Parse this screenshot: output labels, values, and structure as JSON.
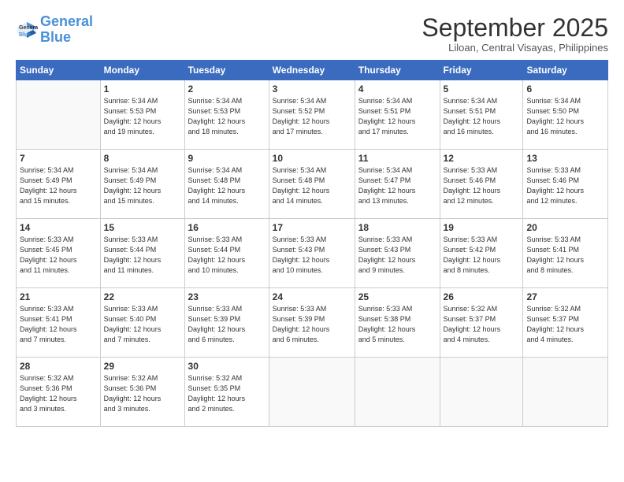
{
  "header": {
    "logo_general": "General",
    "logo_blue": "Blue",
    "month_title": "September 2025",
    "subtitle": "Liloan, Central Visayas, Philippines"
  },
  "weekdays": [
    "Sunday",
    "Monday",
    "Tuesday",
    "Wednesday",
    "Thursday",
    "Friday",
    "Saturday"
  ],
  "weeks": [
    [
      {
        "day": "",
        "info": ""
      },
      {
        "day": "1",
        "info": "Sunrise: 5:34 AM\nSunset: 5:53 PM\nDaylight: 12 hours\nand 19 minutes."
      },
      {
        "day": "2",
        "info": "Sunrise: 5:34 AM\nSunset: 5:53 PM\nDaylight: 12 hours\nand 18 minutes."
      },
      {
        "day": "3",
        "info": "Sunrise: 5:34 AM\nSunset: 5:52 PM\nDaylight: 12 hours\nand 17 minutes."
      },
      {
        "day": "4",
        "info": "Sunrise: 5:34 AM\nSunset: 5:51 PM\nDaylight: 12 hours\nand 17 minutes."
      },
      {
        "day": "5",
        "info": "Sunrise: 5:34 AM\nSunset: 5:51 PM\nDaylight: 12 hours\nand 16 minutes."
      },
      {
        "day": "6",
        "info": "Sunrise: 5:34 AM\nSunset: 5:50 PM\nDaylight: 12 hours\nand 16 minutes."
      }
    ],
    [
      {
        "day": "7",
        "info": "Sunrise: 5:34 AM\nSunset: 5:49 PM\nDaylight: 12 hours\nand 15 minutes."
      },
      {
        "day": "8",
        "info": "Sunrise: 5:34 AM\nSunset: 5:49 PM\nDaylight: 12 hours\nand 15 minutes."
      },
      {
        "day": "9",
        "info": "Sunrise: 5:34 AM\nSunset: 5:48 PM\nDaylight: 12 hours\nand 14 minutes."
      },
      {
        "day": "10",
        "info": "Sunrise: 5:34 AM\nSunset: 5:48 PM\nDaylight: 12 hours\nand 14 minutes."
      },
      {
        "day": "11",
        "info": "Sunrise: 5:34 AM\nSunset: 5:47 PM\nDaylight: 12 hours\nand 13 minutes."
      },
      {
        "day": "12",
        "info": "Sunrise: 5:33 AM\nSunset: 5:46 PM\nDaylight: 12 hours\nand 12 minutes."
      },
      {
        "day": "13",
        "info": "Sunrise: 5:33 AM\nSunset: 5:46 PM\nDaylight: 12 hours\nand 12 minutes."
      }
    ],
    [
      {
        "day": "14",
        "info": "Sunrise: 5:33 AM\nSunset: 5:45 PM\nDaylight: 12 hours\nand 11 minutes."
      },
      {
        "day": "15",
        "info": "Sunrise: 5:33 AM\nSunset: 5:44 PM\nDaylight: 12 hours\nand 11 minutes."
      },
      {
        "day": "16",
        "info": "Sunrise: 5:33 AM\nSunset: 5:44 PM\nDaylight: 12 hours\nand 10 minutes."
      },
      {
        "day": "17",
        "info": "Sunrise: 5:33 AM\nSunset: 5:43 PM\nDaylight: 12 hours\nand 10 minutes."
      },
      {
        "day": "18",
        "info": "Sunrise: 5:33 AM\nSunset: 5:43 PM\nDaylight: 12 hours\nand 9 minutes."
      },
      {
        "day": "19",
        "info": "Sunrise: 5:33 AM\nSunset: 5:42 PM\nDaylight: 12 hours\nand 8 minutes."
      },
      {
        "day": "20",
        "info": "Sunrise: 5:33 AM\nSunset: 5:41 PM\nDaylight: 12 hours\nand 8 minutes."
      }
    ],
    [
      {
        "day": "21",
        "info": "Sunrise: 5:33 AM\nSunset: 5:41 PM\nDaylight: 12 hours\nand 7 minutes."
      },
      {
        "day": "22",
        "info": "Sunrise: 5:33 AM\nSunset: 5:40 PM\nDaylight: 12 hours\nand 7 minutes."
      },
      {
        "day": "23",
        "info": "Sunrise: 5:33 AM\nSunset: 5:39 PM\nDaylight: 12 hours\nand 6 minutes."
      },
      {
        "day": "24",
        "info": "Sunrise: 5:33 AM\nSunset: 5:39 PM\nDaylight: 12 hours\nand 6 minutes."
      },
      {
        "day": "25",
        "info": "Sunrise: 5:33 AM\nSunset: 5:38 PM\nDaylight: 12 hours\nand 5 minutes."
      },
      {
        "day": "26",
        "info": "Sunrise: 5:32 AM\nSunset: 5:37 PM\nDaylight: 12 hours\nand 4 minutes."
      },
      {
        "day": "27",
        "info": "Sunrise: 5:32 AM\nSunset: 5:37 PM\nDaylight: 12 hours\nand 4 minutes."
      }
    ],
    [
      {
        "day": "28",
        "info": "Sunrise: 5:32 AM\nSunset: 5:36 PM\nDaylight: 12 hours\nand 3 minutes."
      },
      {
        "day": "29",
        "info": "Sunrise: 5:32 AM\nSunset: 5:36 PM\nDaylight: 12 hours\nand 3 minutes."
      },
      {
        "day": "30",
        "info": "Sunrise: 5:32 AM\nSunset: 5:35 PM\nDaylight: 12 hours\nand 2 minutes."
      },
      {
        "day": "",
        "info": ""
      },
      {
        "day": "",
        "info": ""
      },
      {
        "day": "",
        "info": ""
      },
      {
        "day": "",
        "info": ""
      }
    ]
  ]
}
